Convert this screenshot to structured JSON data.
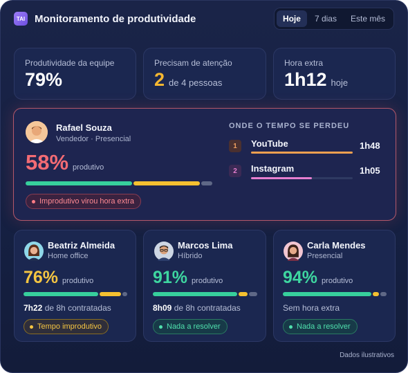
{
  "header": {
    "badge": "TAI",
    "title": "Monitoramento de produtividade",
    "periods": [
      "Hoje",
      "7 dias",
      "Este mês"
    ],
    "active_period": "Hoje"
  },
  "summary": {
    "team": {
      "label": "Produtividade da equipe",
      "value": "79%"
    },
    "attention": {
      "label": "Precisam de atenção",
      "value": "2",
      "suffix": "de 4 pessoas"
    },
    "overtime": {
      "label": "Hora extra",
      "value": "1h12",
      "suffix": "hoje"
    }
  },
  "featured": {
    "name": "Rafael Souza",
    "subtitle": "Vendedor · Presencial",
    "percent": "58%",
    "percent_word": "produtivo",
    "bar": {
      "productive": 0.58,
      "unproductive": 0.36,
      "neutral": 0.06
    },
    "pill": "Improdutivo virou hora extra",
    "lost_title": "ONDE O TEMPO SE PERDEU",
    "lost": [
      {
        "rank": "1",
        "app": "YouTube",
        "time": "1h48",
        "fill": 1.0,
        "color": "#f0a050"
      },
      {
        "rank": "2",
        "app": "Instagram",
        "time": "1h05",
        "fill": 0.6,
        "color": "#e77fd0"
      }
    ]
  },
  "people": [
    {
      "name": "Beatriz Almeida",
      "subtitle": "Home office",
      "percent": "76%",
      "percent_word": "produtivo",
      "bar": {
        "productive": 0.74,
        "unproductive": 0.21,
        "neutral": 0.05
      },
      "hours_value": "7h22",
      "hours_rest": "de 8h contratadas",
      "pill": "Tempo improdutivo",
      "pill_type": "yellow"
    },
    {
      "name": "Marcos Lima",
      "subtitle": "Híbrido",
      "percent": "91%",
      "percent_word": "produtivo",
      "bar": {
        "productive": 0.83,
        "unproductive": 0.09,
        "neutral": 0.08
      },
      "hours_value": "8h09",
      "hours_rest": "de 8h contratadas",
      "pill": "Nada a resolver",
      "pill_type": "green"
    },
    {
      "name": "Carla Mendes",
      "subtitle": "Presencial",
      "percent": "94%",
      "percent_word": "produtivo",
      "bar": {
        "productive": 0.88,
        "unproductive": 0.06,
        "neutral": 0.06
      },
      "hours_value": "",
      "hours_rest": "Sem hora extra",
      "pill": "Nada a resolver",
      "pill_type": "green"
    }
  ],
  "footnote": "Dados ilustrativos"
}
